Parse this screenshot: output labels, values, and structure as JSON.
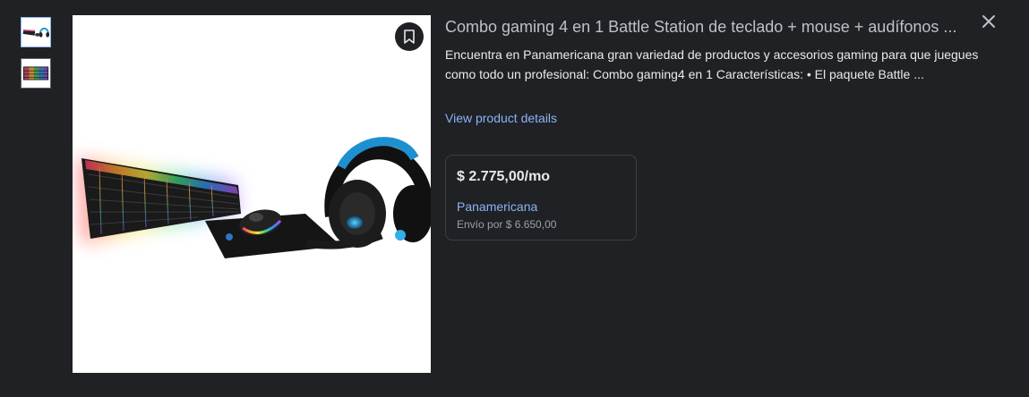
{
  "thumbnails": [
    {
      "icon": "gaming-combo-thumbnail",
      "selected": true
    },
    {
      "icon": "keyboard-thumbnail",
      "selected": false
    }
  ],
  "product": {
    "title": "Combo gaming 4 en 1 Battle Station de teclado + mouse + audífonos ...",
    "description": "Encuentra en Panamericana gran variedad de productos y accesorios gaming para que juegues como todo un profesional: Combo gaming4 en 1 Características: • El paquete Battle ...",
    "details_link": "View product details"
  },
  "offer": {
    "price": "$ 2.775,00/mo",
    "merchant": "Panamericana",
    "shipping": "Envío por $ 6.650,00"
  },
  "icons": {
    "save": "bookmark-icon",
    "close": "close-icon"
  },
  "colors": {
    "background": "#202124",
    "link": "#8ab4f8",
    "card_border": "#3c4043"
  }
}
